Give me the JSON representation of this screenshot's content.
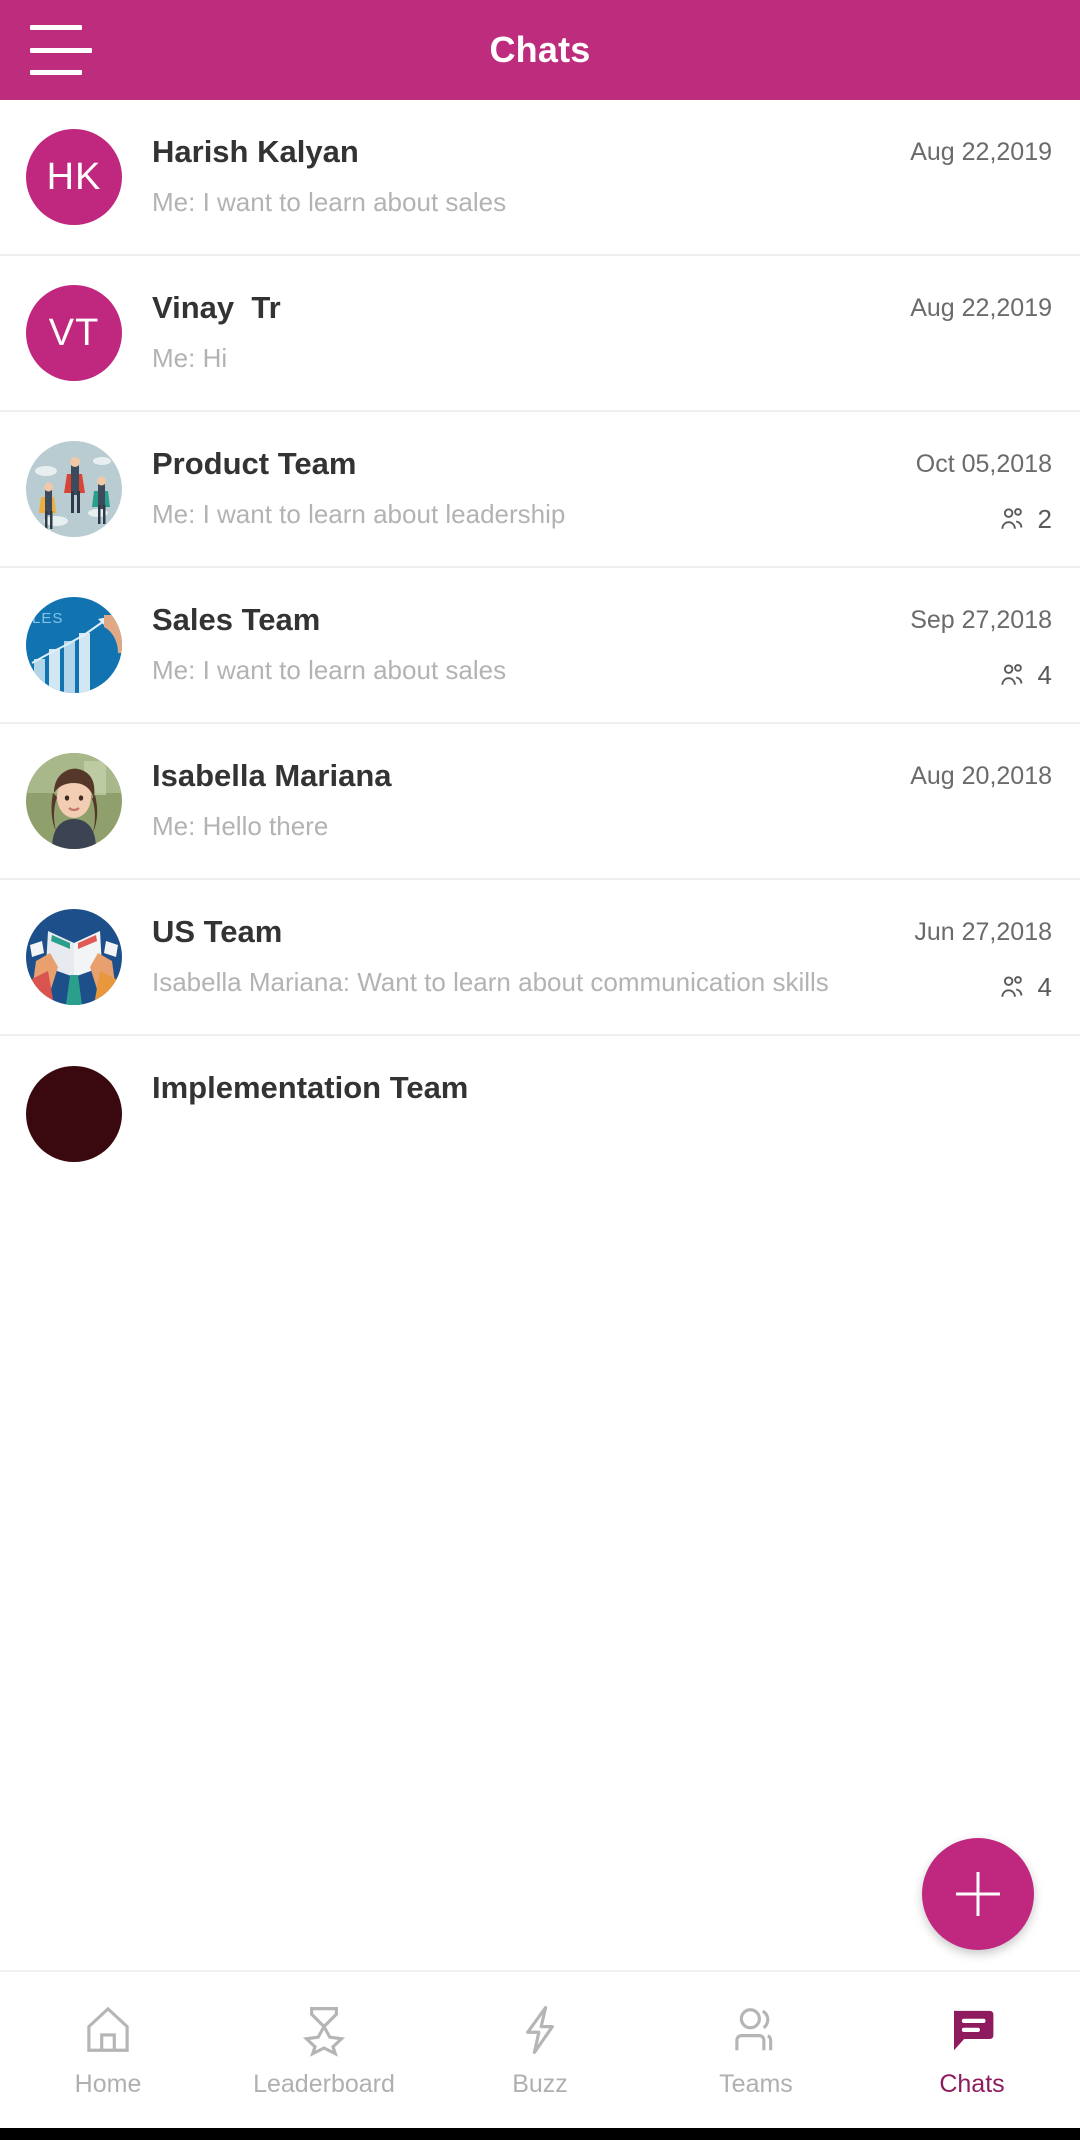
{
  "header": {
    "title": "Chats",
    "menu_icon": "hamburger-menu-icon",
    "background_color": "#be2c7d"
  },
  "chats": [
    {
      "name": "Harish Kalyan",
      "message": "Me: I want to learn about sales",
      "date": "Aug 22,2019",
      "avatar_type": "initials",
      "initials": "HK",
      "avatar_color": "#c0277e",
      "members": null
    },
    {
      "name": "Vinay  Tr",
      "message": "Me: Hi",
      "date": "Aug 22,2019",
      "avatar_type": "initials",
      "initials": "VT",
      "avatar_color": "#c0277e",
      "members": null
    },
    {
      "name": "Product Team",
      "message": "Me: I want to learn about leadership",
      "date": "Oct 05,2018",
      "avatar_type": "art-superheroes",
      "initials": "",
      "avatar_color": "#b9cdd2",
      "members": "2"
    },
    {
      "name": "Sales Team",
      "message": "Me: I want to learn about sales",
      "date": "Sep 27,2018",
      "avatar_type": "art-saleschart",
      "initials": "",
      "avatar_color": "#1272b0",
      "members": "4"
    },
    {
      "name": "Isabella Mariana",
      "message": "Me: Hello there",
      "date": "Aug 20,2018",
      "avatar_type": "art-portrait",
      "initials": "",
      "avatar_color": "#8a9a6a",
      "members": null
    },
    {
      "name": "US Team",
      "message": "Isabella Mariana: Want to learn about communication skills",
      "date": "Jun 27,2018",
      "avatar_type": "art-books",
      "initials": "",
      "avatar_color": "#1d4f8a",
      "members": "4"
    },
    {
      "name": "Implementation Team",
      "message": "",
      "date": "",
      "avatar_type": "dark",
      "initials": "",
      "avatar_color": "#3a090f",
      "members": null
    }
  ],
  "fab": {
    "label": "+",
    "icon": "plus-icon",
    "color": "#c0277e"
  },
  "bottom_nav": {
    "active_color": "#8e1b5e",
    "inactive_color": "#b0b0b0",
    "items": [
      {
        "label": "Home",
        "icon": "home-icon",
        "active": false
      },
      {
        "label": "Leaderboard",
        "icon": "medal-icon",
        "active": false
      },
      {
        "label": "Buzz",
        "icon": "lightning-bolt-icon",
        "active": false
      },
      {
        "label": "Teams",
        "icon": "people-icon",
        "active": false
      },
      {
        "label": "Chats",
        "icon": "chat-bubble-icon",
        "active": true
      }
    ]
  },
  "member_icon_name": "group-members-icon"
}
